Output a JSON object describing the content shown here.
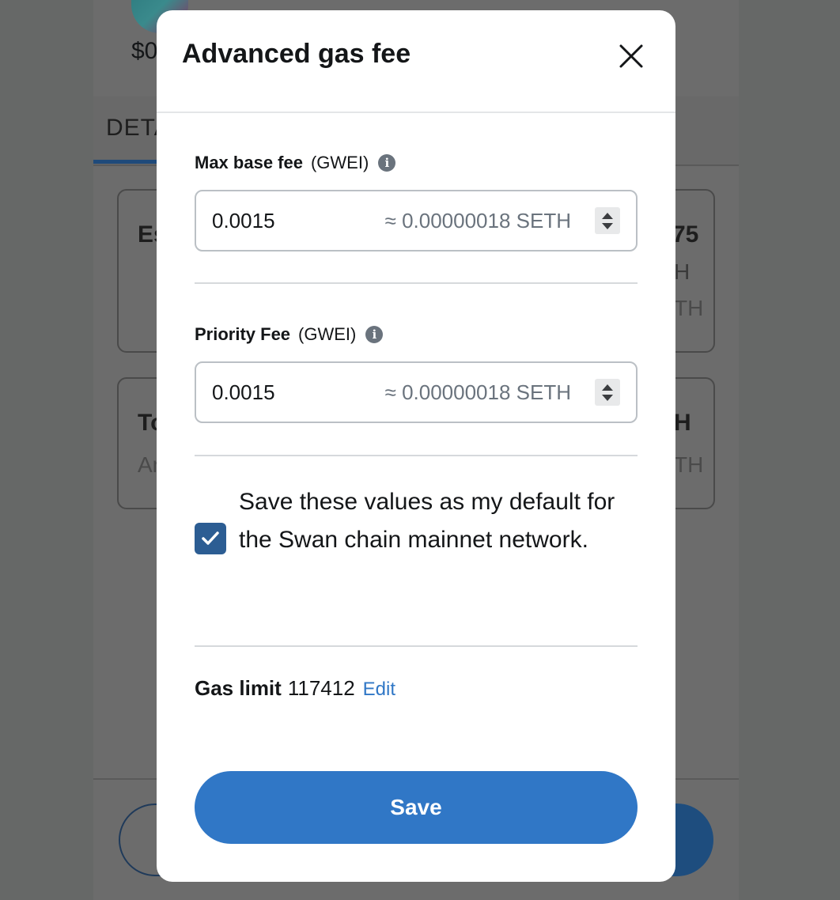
{
  "background": {
    "balance_partial": "$0",
    "tab_partial": "DETA",
    "card1_title_partial": "Es",
    "card1_right_partial": "75",
    "card1_right_line2": "H",
    "card1_right_line3": "TH",
    "card2_title_partial": "To",
    "card2_sub_partial": "Ar",
    "card2_right_line1": "H",
    "card2_right_line2": "TH"
  },
  "modal": {
    "title": "Advanced gas fee",
    "close_icon": "close-icon",
    "max_base_fee": {
      "label": "Max base fee",
      "unit": "(GWEI)",
      "value": "0.0015",
      "approx": "≈ 0.00000018 SETH",
      "info_icon": "info-icon"
    },
    "priority_fee": {
      "label": "Priority Fee",
      "unit": "(GWEI)",
      "value": "0.0015",
      "approx": "≈ 0.00000018 SETH",
      "info_icon": "info-icon"
    },
    "save_default": {
      "checked": true,
      "text": "Save these values as my default for the Swan chain mainnet network."
    },
    "gas_limit": {
      "label": "Gas limit",
      "value": "117412",
      "edit_label": "Edit"
    },
    "save_button": "Save"
  },
  "colors": {
    "accent": "#3077c6",
    "checkbox": "#2c5d93",
    "overlay": "#666867"
  }
}
